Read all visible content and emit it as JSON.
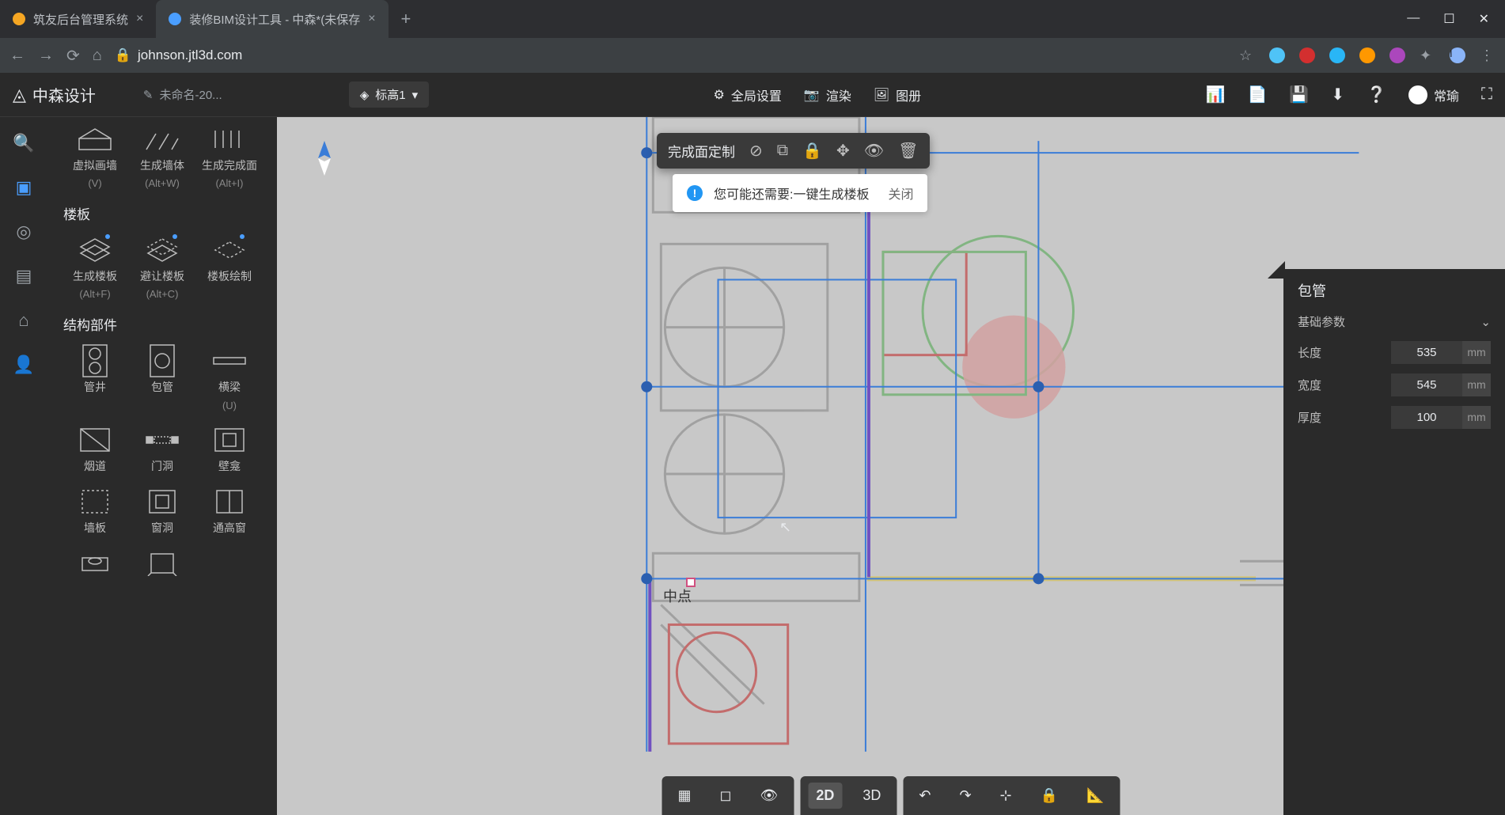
{
  "browser": {
    "tabs": [
      {
        "title": "筑友后台管理系统",
        "active": false
      },
      {
        "title": "装修BIM设计工具 - 中森*(未保存",
        "active": true
      }
    ],
    "url": "johnson.jtl3d.com"
  },
  "header": {
    "logo": "中森设计",
    "file_name": "未命名-20...",
    "level": "标高1",
    "global_settings": "全局设置",
    "render": "渲染",
    "gallery": "图册",
    "user_name": "常瑜"
  },
  "palette": {
    "row1": [
      {
        "label": "虚拟画墙",
        "shortcut": "(V)"
      },
      {
        "label": "生成墙体",
        "shortcut": "(Alt+W)"
      },
      {
        "label": "生成完成面",
        "shortcut": "(Alt+I)"
      }
    ],
    "section_floor": "楼板",
    "row2": [
      {
        "label": "生成楼板",
        "shortcut": "(Alt+F)"
      },
      {
        "label": "避让楼板",
        "shortcut": "(Alt+C)"
      },
      {
        "label": "楼板绘制",
        "shortcut": ""
      }
    ],
    "section_struct": "结构部件",
    "row3": [
      {
        "label": "管井",
        "shortcut": ""
      },
      {
        "label": "包管",
        "shortcut": ""
      },
      {
        "label": "横梁",
        "shortcut": "(U)"
      }
    ],
    "row4": [
      {
        "label": "烟道",
        "shortcut": ""
      },
      {
        "label": "门洞",
        "shortcut": ""
      },
      {
        "label": "壁龛",
        "shortcut": ""
      }
    ],
    "row5": [
      {
        "label": "墙板",
        "shortcut": ""
      },
      {
        "label": "窗洞",
        "shortcut": ""
      },
      {
        "label": "通高窗",
        "shortcut": ""
      }
    ]
  },
  "float_toolbar": {
    "label": "完成面定制"
  },
  "suggestion": {
    "text": "您可能还需要:一键生成楼板",
    "close": "关闭"
  },
  "canvas": {
    "midpoint": "中点"
  },
  "right_panel": {
    "title": "包管",
    "section": "基础参数",
    "params": [
      {
        "label": "长度",
        "value": "535",
        "unit": "mm"
      },
      {
        "label": "宽度",
        "value": "545",
        "unit": "mm"
      },
      {
        "label": "厚度",
        "value": "100",
        "unit": "mm"
      }
    ]
  },
  "bottom_bar": {
    "view_2d": "2D",
    "view_3d": "3D"
  }
}
